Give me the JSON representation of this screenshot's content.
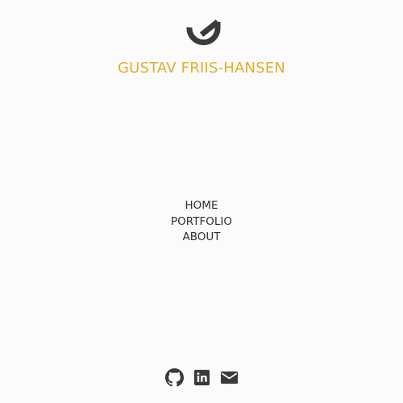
{
  "brand": {
    "name": "GUSTAV FRIIS-HANSEN",
    "logo_icon": "g-arc-logo-icon",
    "accent_color": "#e3ad2b",
    "text_color": "#3a3a3a"
  },
  "nav": {
    "items": [
      {
        "label": "HOME"
      },
      {
        "label": "PORTFOLIO"
      },
      {
        "label": "ABOUT"
      }
    ]
  },
  "social": {
    "links": [
      {
        "icon": "github-icon",
        "name": "github"
      },
      {
        "icon": "linkedin-icon",
        "name": "linkedin"
      },
      {
        "icon": "envelope-icon",
        "name": "email"
      }
    ]
  }
}
